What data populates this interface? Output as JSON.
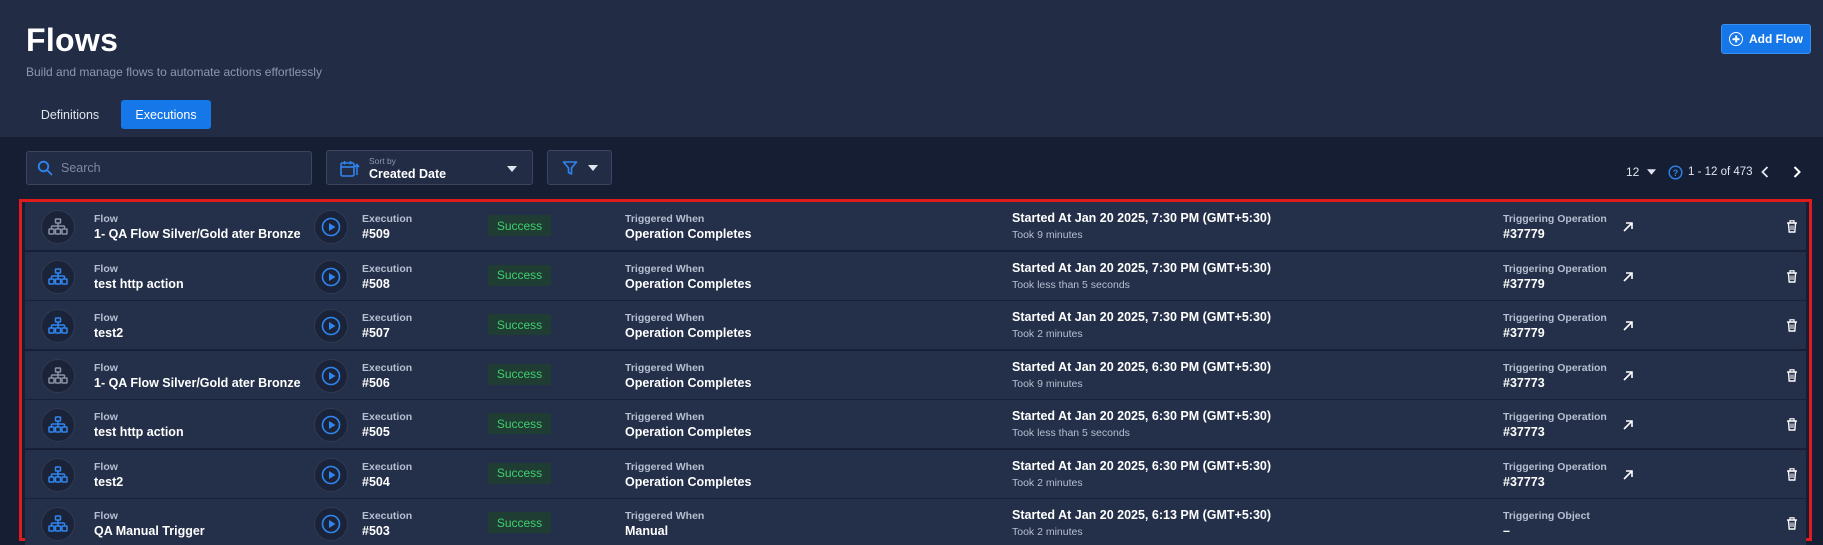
{
  "header": {
    "title": "Flows",
    "subtitle": "Build and manage flows to automate actions effortlessly",
    "add_button": "Add Flow"
  },
  "tabs": [
    {
      "label": "Definitions",
      "active": false
    },
    {
      "label": "Executions",
      "active": true
    }
  ],
  "toolbar": {
    "search_placeholder": "Search",
    "sort_label": "Sort by",
    "sort_value": "Created Date"
  },
  "pagination": {
    "per_page": "12",
    "range": "1 - 12 of 473"
  },
  "labels": {
    "flow": "Flow",
    "execution": "Execution",
    "triggered_when": "Triggered When",
    "triggering_operation": "Triggering Operation",
    "triggering_object": "Triggering Object"
  },
  "colors": {
    "accent": "#1677e8",
    "success_text": "#3fcf6e",
    "highlight_border": "#e01b1b",
    "flow_icon_blue": "#2f86f0",
    "flow_icon_gray": "#8a93a6"
  },
  "rows": [
    {
      "icon": "flow-icon-gray",
      "flow": "1- QA Flow Silver/Gold ater Bronze",
      "execution": "#509",
      "status": "Success",
      "trigger": "Operation Completes",
      "started": "Started At Jan 20 2025, 7:30 PM (GMT+5:30)",
      "took": "Took 9 minutes",
      "trig_label": "Triggering Operation",
      "trig_value": "#37779",
      "has_link": true
    },
    {
      "icon": "flow-icon-blue",
      "flow": "test http action",
      "execution": "#508",
      "status": "Success",
      "trigger": "Operation Completes",
      "started": "Started At Jan 20 2025, 7:30 PM (GMT+5:30)",
      "took": "Took less than 5 seconds",
      "trig_label": "Triggering Operation",
      "trig_value": "#37779",
      "has_link": true
    },
    {
      "icon": "flow-icon-blue",
      "flow": "test2",
      "execution": "#507",
      "status": "Success",
      "trigger": "Operation Completes",
      "started": "Started At Jan 20 2025, 7:30 PM (GMT+5:30)",
      "took": "Took 2 minutes",
      "trig_label": "Triggering Operation",
      "trig_value": "#37779",
      "has_link": true
    },
    {
      "icon": "flow-icon-gray",
      "flow": "1- QA Flow Silver/Gold ater Bronze",
      "execution": "#506",
      "status": "Success",
      "trigger": "Operation Completes",
      "started": "Started At Jan 20 2025, 6:30 PM (GMT+5:30)",
      "took": "Took 9 minutes",
      "trig_label": "Triggering Operation",
      "trig_value": "#37773",
      "has_link": true
    },
    {
      "icon": "flow-icon-blue",
      "flow": "test http action",
      "execution": "#505",
      "status": "Success",
      "trigger": "Operation Completes",
      "started": "Started At Jan 20 2025, 6:30 PM (GMT+5:30)",
      "took": "Took less than 5 seconds",
      "trig_label": "Triggering Operation",
      "trig_value": "#37773",
      "has_link": true
    },
    {
      "icon": "flow-icon-blue",
      "flow": "test2",
      "execution": "#504",
      "status": "Success",
      "trigger": "Operation Completes",
      "started": "Started At Jan 20 2025, 6:30 PM (GMT+5:30)",
      "took": "Took 2 minutes",
      "trig_label": "Triggering Operation",
      "trig_value": "#37773",
      "has_link": true
    },
    {
      "icon": "flow-icon-blue",
      "flow": "QA Manual Trigger",
      "execution": "#503",
      "status": "Success",
      "trigger": "Manual",
      "started": "Started At Jan 20 2025, 6:13 PM (GMT+5:30)",
      "took": "Took 2 minutes",
      "trig_label": "Triggering Object",
      "trig_value": "–",
      "has_link": false
    }
  ]
}
